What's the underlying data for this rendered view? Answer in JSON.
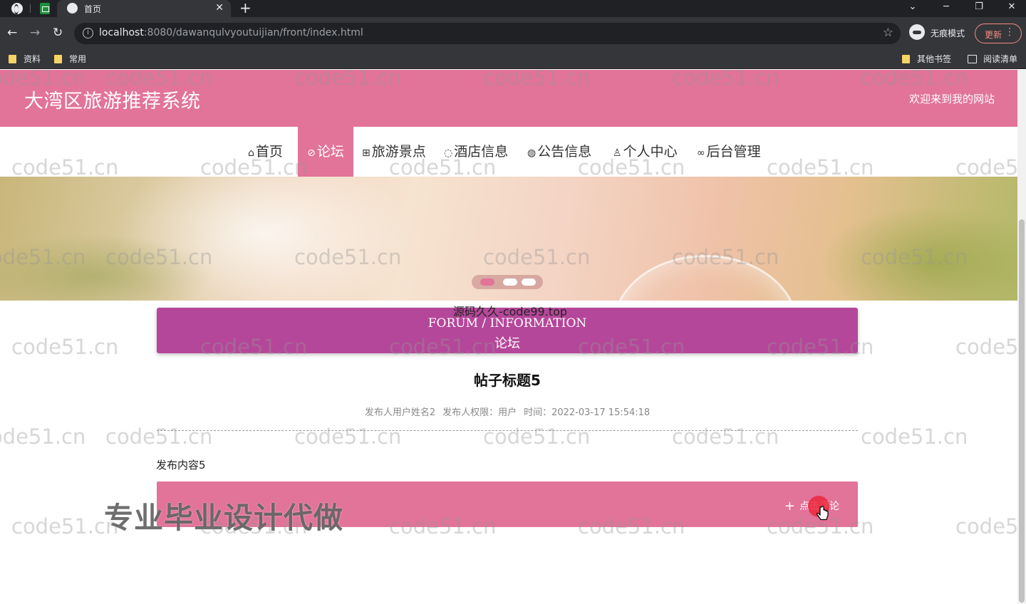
{
  "browser": {
    "tab_title": "首页",
    "url_host": "localhost",
    "url_path": ":8080/dawanqulvyoutuijian/front/index.html",
    "profile_label": "无痕模式",
    "update_label": "更新",
    "bookmarks": [
      "资料",
      "常用",
      "其他书签",
      "阅读清单"
    ]
  },
  "site": {
    "title": "大湾区旅游推荐系统",
    "welcome": "欢迎来到我的网站"
  },
  "nav": {
    "items": [
      {
        "label": "首页",
        "icon": "home-icon"
      },
      {
        "label": "论坛",
        "icon": "forum-icon",
        "active": true
      },
      {
        "label": "旅游景点",
        "icon": "scenic-icon"
      },
      {
        "label": "酒店信息",
        "icon": "hotel-icon"
      },
      {
        "label": "公告信息",
        "icon": "notice-icon"
      },
      {
        "label": "个人中心",
        "icon": "user-icon"
      },
      {
        "label": "后台管理",
        "icon": "link-icon"
      }
    ]
  },
  "carousel": {
    "slides": 3,
    "active_index": 0
  },
  "section": {
    "title_en": "FORUM / INFORMATION",
    "title_cn": "论坛"
  },
  "post": {
    "title": "帖子标题5",
    "author": "发布人用户姓名2",
    "role": "发布人权限：用户",
    "time": "时间：2022-03-17 15:54:18",
    "content": "发布内容5"
  },
  "comment": {
    "button_label": "点击评论"
  },
  "overlays": {
    "watermark": "code51.cn",
    "promo": "专业毕业设计代做",
    "source": "源码久久-code99.top"
  },
  "colors": {
    "accent": "#e27399",
    "section_head": "#b5479a"
  }
}
